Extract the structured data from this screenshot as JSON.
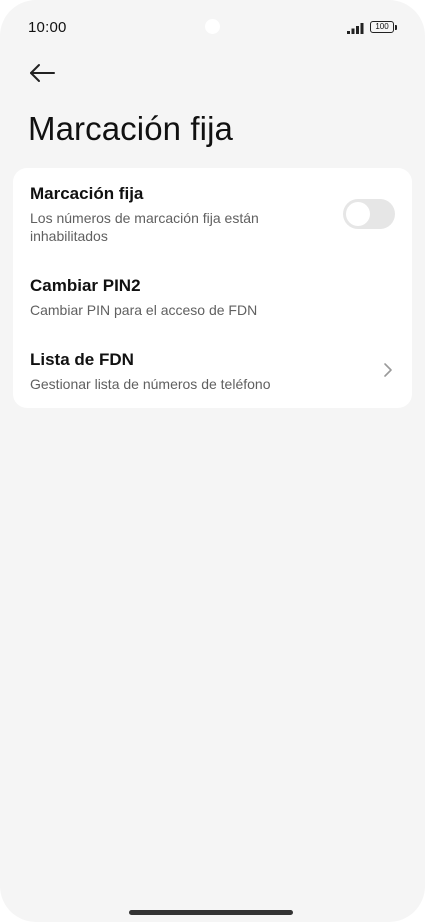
{
  "status_bar": {
    "time": "10:00",
    "battery": "100",
    "icons": [
      "signal-icon",
      "battery-icon"
    ]
  },
  "header": {
    "back_icon": "arrow-left-icon",
    "title": "Marcación fija"
  },
  "settings": {
    "items": [
      {
        "title": "Marcación fija",
        "subtitle": "Los números de marcación fija están inhabilitados",
        "control": "toggle",
        "toggle_on": false
      },
      {
        "title": "Cambiar PIN2",
        "subtitle": "Cambiar PIN para el acceso de FDN",
        "control": "none"
      },
      {
        "title": "Lista de FDN",
        "subtitle": "Gestionar lista de números de teléfono",
        "control": "chevron-right-icon"
      }
    ]
  },
  "colors": {
    "background": "#f5f5f5",
    "card": "#ffffff",
    "primary_text": "#111111",
    "secondary_text": "#606060",
    "toggle_off_track": "#e6e6e6"
  }
}
